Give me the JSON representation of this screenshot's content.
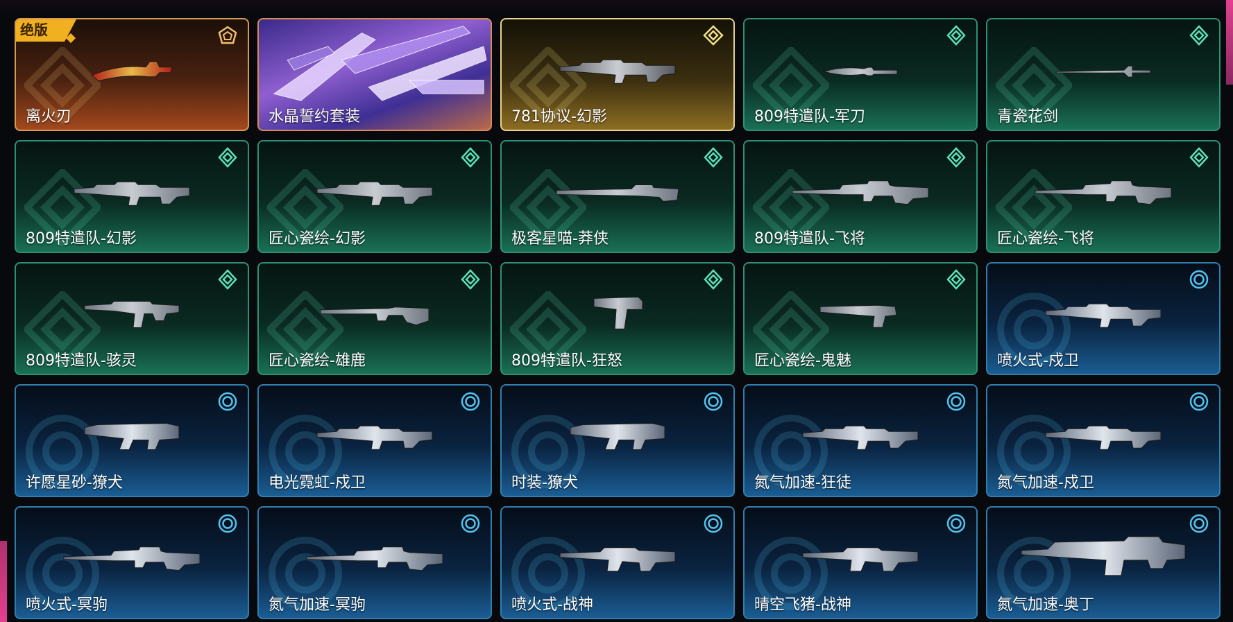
{
  "badge_label": "绝版",
  "colors": {
    "green": "#2c9272",
    "blue": "#2e7fb0",
    "gold": "#e8d48a",
    "orange": "#d99a52",
    "accent_badge": "#f0b020"
  },
  "items": [
    {
      "name": "离火刃",
      "tier": "orange",
      "weapon": "knife-curved",
      "tier_icon": "pentagon-icon"
    },
    {
      "name": "水晶誓约套装",
      "tier": "purple",
      "weapon": "bundle",
      "tier_icon": ""
    },
    {
      "name": "781协议-幻影",
      "tier": "gold",
      "weapon": "rifle",
      "tier_icon": "diamond-icon"
    },
    {
      "name": "809特遣队-军刀",
      "tier": "green",
      "weapon": "knife",
      "tier_icon": "hex-icon"
    },
    {
      "name": "青瓷花剑",
      "tier": "green",
      "weapon": "rapier",
      "tier_icon": "hex-icon"
    },
    {
      "name": "809特遣队-幻影",
      "tier": "green",
      "weapon": "rifle",
      "tier_icon": "hex-icon"
    },
    {
      "name": "匠心瓷绘-幻影",
      "tier": "green",
      "weapon": "rifle",
      "tier_icon": "hex-icon"
    },
    {
      "name": "极客星喵-莽侠",
      "tier": "green",
      "weapon": "shotgun-long",
      "tier_icon": "hex-icon"
    },
    {
      "name": "809特遣队-飞将",
      "tier": "green",
      "weapon": "sniper",
      "tier_icon": "hex-icon"
    },
    {
      "name": "匠心瓷绘-飞将",
      "tier": "green",
      "weapon": "sniper",
      "tier_icon": "hex-icon"
    },
    {
      "name": "809特遣队-骇灵",
      "tier": "green",
      "weapon": "smg",
      "tier_icon": "hex-icon"
    },
    {
      "name": "匠心瓷绘-雄鹿",
      "tier": "green",
      "weapon": "shotgun",
      "tier_icon": "hex-icon"
    },
    {
      "name": "809特遣队-狂怒",
      "tier": "green",
      "weapon": "pistol",
      "tier_icon": "hex-icon"
    },
    {
      "name": "匠心瓷绘-鬼魅",
      "tier": "green",
      "weapon": "pistol-long",
      "tier_icon": "hex-icon"
    },
    {
      "name": "喷火式-戍卫",
      "tier": "blue",
      "weapon": "rifle",
      "tier_icon": "ring-icon"
    },
    {
      "name": "许愿星砂-獠犬",
      "tier": "blue",
      "weapon": "bullpup",
      "tier_icon": "ring-icon"
    },
    {
      "name": "电光霓虹-戍卫",
      "tier": "blue",
      "weapon": "rifle",
      "tier_icon": "ring-icon"
    },
    {
      "name": "时装-獠犬",
      "tier": "blue",
      "weapon": "bullpup",
      "tier_icon": "ring-icon"
    },
    {
      "name": "氮气加速-狂徒",
      "tier": "blue",
      "weapon": "rifle",
      "tier_icon": "ring-icon"
    },
    {
      "name": "氮气加速-戍卫",
      "tier": "blue",
      "weapon": "rifle",
      "tier_icon": "ring-icon"
    },
    {
      "name": "喷火式-冥驹",
      "tier": "blue",
      "weapon": "sniper",
      "tier_icon": "ring-icon"
    },
    {
      "name": "氮气加速-冥驹",
      "tier": "blue",
      "weapon": "sniper",
      "tier_icon": "ring-icon"
    },
    {
      "name": "喷火式-战神",
      "tier": "blue",
      "weapon": "lmg",
      "tier_icon": "ring-icon"
    },
    {
      "name": "晴空飞猪-战神",
      "tier": "blue",
      "weapon": "lmg",
      "tier_icon": "ring-icon"
    },
    {
      "name": "氮气加速-奥丁",
      "tier": "blue",
      "weapon": "heavy",
      "tier_icon": "ring-icon"
    }
  ]
}
